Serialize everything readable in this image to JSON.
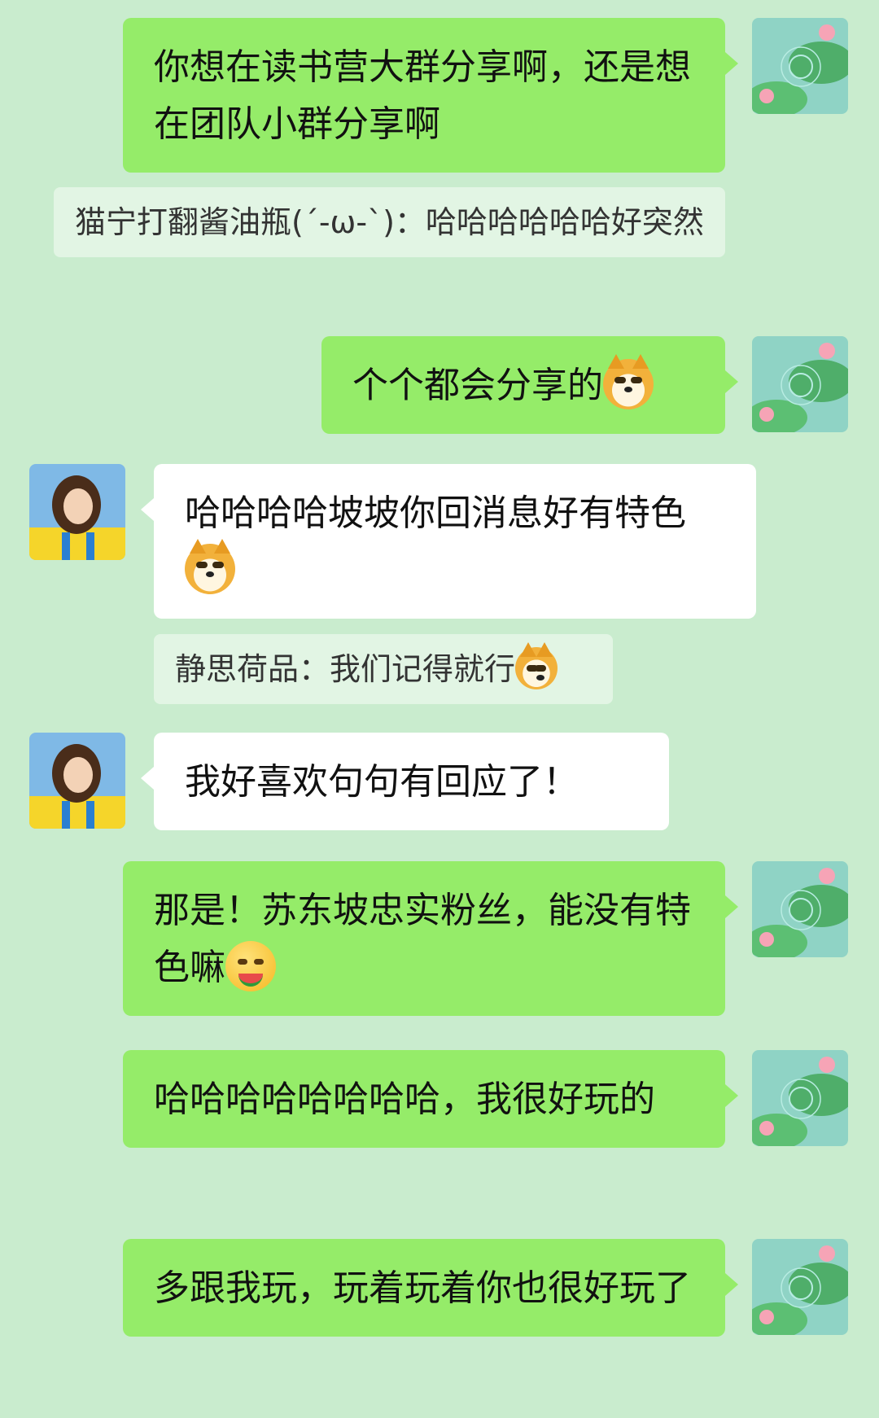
{
  "conversation": {
    "messages": [
      {
        "sender": "me",
        "text": "你想在读书营大群分享啊，还是想在团队小群分享啊"
      },
      {
        "sender": "quote",
        "text": "猫宁打翻酱油瓶(´-ω-`)：哈哈哈哈哈哈好突然"
      },
      {
        "sender": "me",
        "text": "个个都会分享的",
        "emoji": "doge-emoji"
      },
      {
        "sender": "other",
        "text": "哈哈哈哈坡坡你回消息好有特色",
        "emoji": "doge-emoji"
      },
      {
        "sender": "quote",
        "text": "静思荷品：我们记得就行",
        "emoji": "doge-emoji"
      },
      {
        "sender": "other",
        "text": "我好喜欢句句有回应了！"
      },
      {
        "sender": "me",
        "text": "那是！苏东坡忠实粉丝，能没有特色嘛",
        "emoji": "watermelon-smile-emoji"
      },
      {
        "sender": "me",
        "text": "哈哈哈哈哈哈哈哈，我很好玩的"
      },
      {
        "sender": "me",
        "text": "多跟我玩，玩着玩着你也很好玩了"
      }
    ]
  },
  "colors": {
    "background": "#c9ecce",
    "my_bubble": "#95ec69",
    "their_bubble": "#ffffff",
    "quote_bg": "#e2f5e4"
  },
  "avatars": {
    "me": "lotus-pond-avatar",
    "other": "girl-portrait-avatar"
  }
}
